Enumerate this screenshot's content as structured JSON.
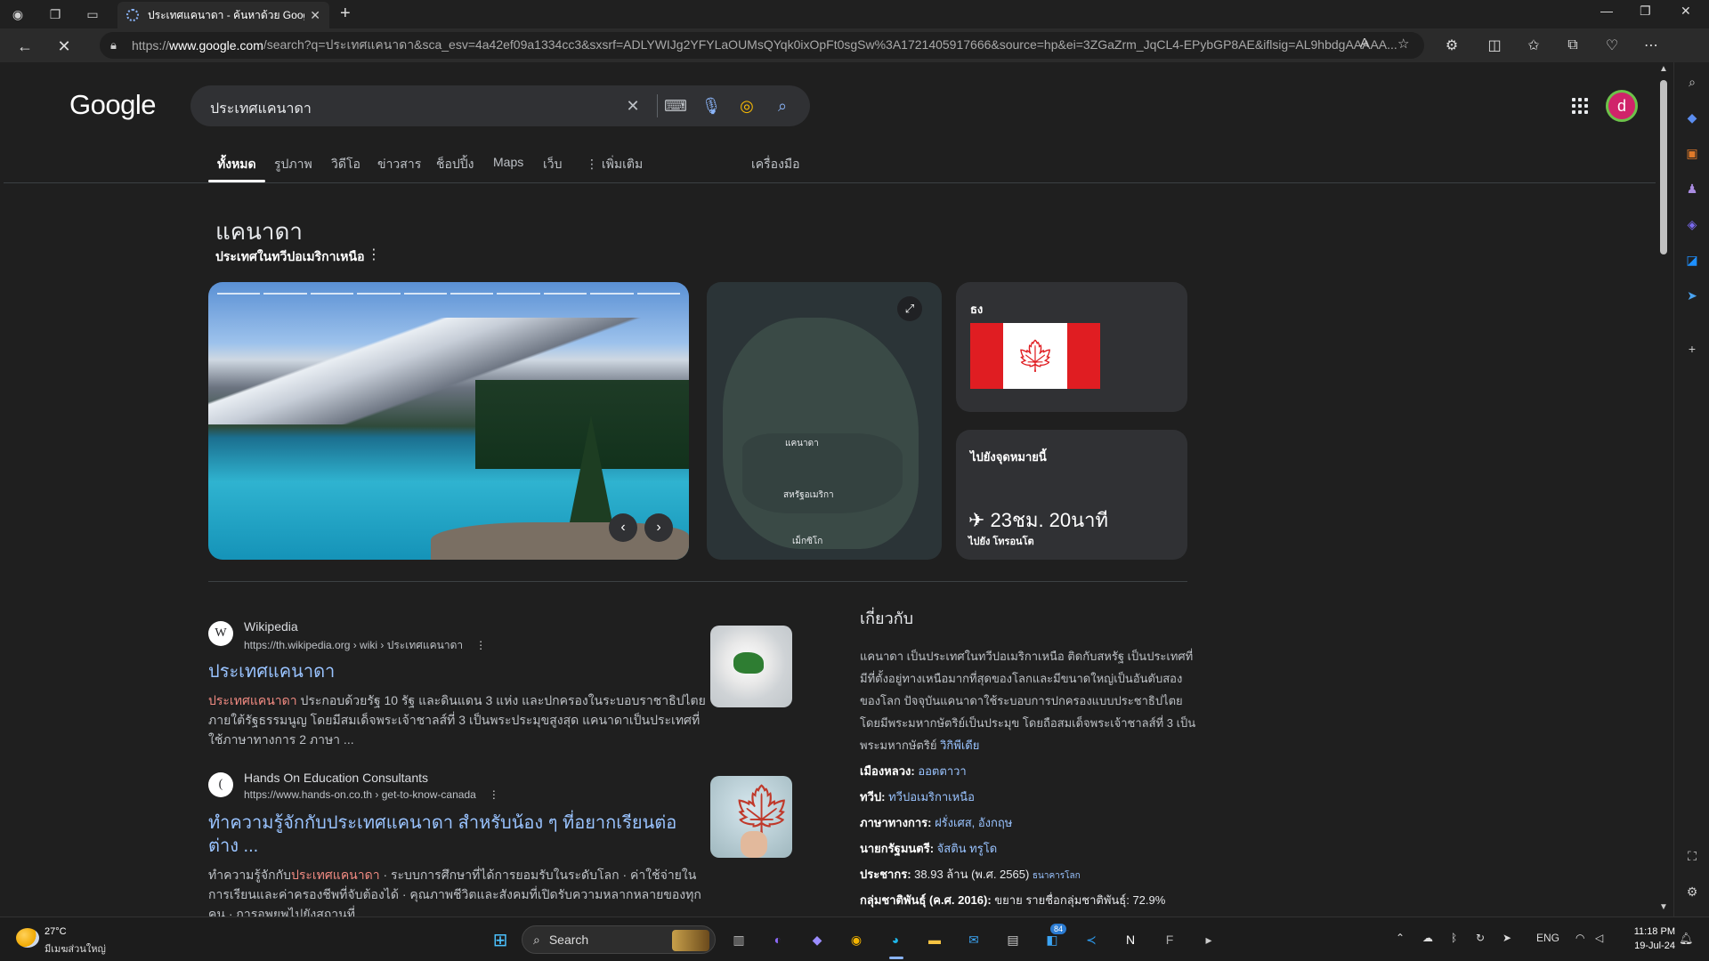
{
  "browser": {
    "tab_title": "ประเทศแคนาดา - ค้นหาด้วย Google",
    "url_prefix": "https://",
    "url_host": "www.google.com",
    "url_rest": "/search?q=ประเทศแคนาดา&sca_esv=4a42ef09a1334cc3&sxsrf=ADLYWIJg2YFYLaOUMsQYqk0ixOpFt0sgSw%3A1721405917666&source=hp&ei=3ZGaZrm_JqCL4-EPybGP8AE&iflsig=AL9hbdgAAAAA..."
  },
  "google": {
    "logo": "Google",
    "query": "ประเทศแคนาดา",
    "avatar_letter": "d",
    "tabs": [
      "ทั้งหมด",
      "รูปภาพ",
      "วิดีโอ",
      "ข่าวสาร",
      "ช็อปปิ้ง",
      "Maps",
      "เว็บ"
    ],
    "more_label": "⋮ เพิ่มเติม",
    "tools_label": "เครื่องมือ"
  },
  "knowledge": {
    "title": "แคนาดา",
    "subtitle": "ประเทศในทวีปอเมริกาเหนือ",
    "map_labels": {
      "canada": "แคนาดา",
      "usa": "สหรัฐอเมริกา",
      "mexico": "เม็กซิโก"
    },
    "flag_label": "ธง",
    "travel_label": "ไปยังจุดหมายนี้",
    "travel_time": "✈ 23ชม. 20นาที",
    "travel_dest": "ไปยัง โทรอนโต"
  },
  "results": [
    {
      "site": "Wikipedia",
      "favicon": "W",
      "url": "https://th.wikipedia.org › wiki › ประเทศแคนาดา",
      "title": "ประเทศแคนาดา",
      "snippet_hl": "ประเทศแคนาดา",
      "snippet": " ประกอบด้วยรัฐ 10 รัฐ และดินแดน 3 แห่ง และปกครองในระบอบราชาธิปไตยภายใต้รัฐธรรมนูญ โดยมีสมเด็จพระเจ้าชาลส์ที่ 3 เป็นพระประมุขสูงสุด แคนาดาเป็นประเทศที่ใช้ภาษาทางการ 2 ภาษา ..."
    },
    {
      "site": "Hands On Education Consultants",
      "favicon": "(",
      "url": "https://www.hands-on.co.th › get-to-know-canada",
      "title": "ทำความรู้จักกับประเทศแคนาดา สำหรับน้อง ๆ ที่อยากเรียนต่อต่าง ...",
      "snippet_pre": "ทำความรู้จักกับ",
      "snippet_hl": "ประเทศแคนาดา",
      "snippet": " · ระบบการศึกษาที่ได้การยอมรับในระดับโลก · ค่าใช้จ่ายในการเรียนและค่าครองชีพที่จับต้องได้ · คุณภาพชีวิตและสังคมที่เปิดรับความหลากหลายของทุกคน · การอพยพไปยังสถานที่"
    }
  ],
  "about": {
    "heading": "เกี่ยวกับ",
    "description": "แคนาดา เป็นประเทศในทวีปอเมริกาเหนือ ติดกับสหรัฐ เป็นประเทศที่มีที่ตั้งอยู่ทางเหนือมากที่สุดของโลกและมีขนาดใหญ่เป็นอันดับสองของโลก ปัจจุบันแคนาดาใช้ระบอบการปกครองแบบประชาธิปไตยโดยมีพระมหากษัตริย์เป็นประมุข โดยถือสมเด็จพระเจ้าชาลส์ที่ 3 เป็นพระมหากษัตริย์ ",
    "source_link": "วิกิพีเดีย",
    "facts": [
      {
        "label": "เมืองหลวง:",
        "value": "ออตตาวา"
      },
      {
        "label": "ทวีป:",
        "value": "ทวีปอเมริกาเหนือ"
      },
      {
        "label": "ภาษาทางการ:",
        "value": "ฝรั่งเศส, อังกฤษ"
      },
      {
        "label": "นายกรัฐมนตรี:",
        "value": "จัสติน ทรูโด"
      },
      {
        "label": "ประชากร:",
        "value_plain": "38.93 ล้าน (พ.ศ. 2565) ",
        "small_link": "ธนาคารโลก"
      },
      {
        "label": "กลุ่มชาติพันธุ์ (ค.ศ. 2016):",
        "value_plain": "ขยาย รายชื่อกลุ่มชาติพันธุ์: 72.9%"
      }
    ]
  },
  "taskbar": {
    "temp": "27°C",
    "weather_desc": "มีเมฆส่วนใหญ่",
    "search_label": "Search",
    "badge": "84",
    "lang": "ENG",
    "time": "11:18 PM",
    "date": "19-Jul-24"
  }
}
